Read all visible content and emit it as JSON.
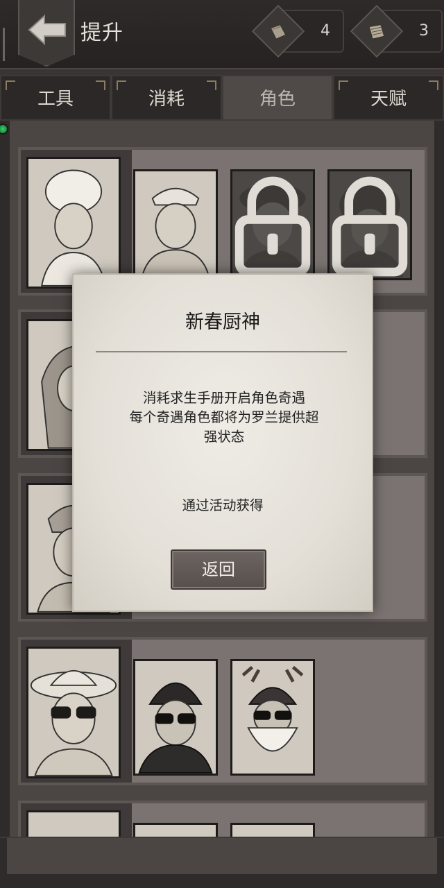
{
  "header": {
    "title": "提升",
    "resources": [
      {
        "icon": "manual-book-icon",
        "count": "4"
      },
      {
        "icon": "scroll-icon",
        "count": "3"
      }
    ]
  },
  "tabs": [
    {
      "label": "工具",
      "active": false
    },
    {
      "label": "消耗",
      "active": false
    },
    {
      "label": "角色",
      "active": true
    },
    {
      "label": "天赋",
      "active": false
    }
  ],
  "colors": {
    "background": "#3a3534",
    "active_tab": "#4f4a48",
    "dialog_paper": "#e9e6df",
    "button": "#5f5855",
    "notification_dot": "#2bbf5a"
  },
  "dialog": {
    "title": "新春厨神",
    "description_lines": [
      "消耗求生手册开启角色奇遇",
      "每个奇遇角色都将为罗兰提供超",
      "强状态"
    ],
    "source": "通过活动获得",
    "return_label": "返回"
  }
}
